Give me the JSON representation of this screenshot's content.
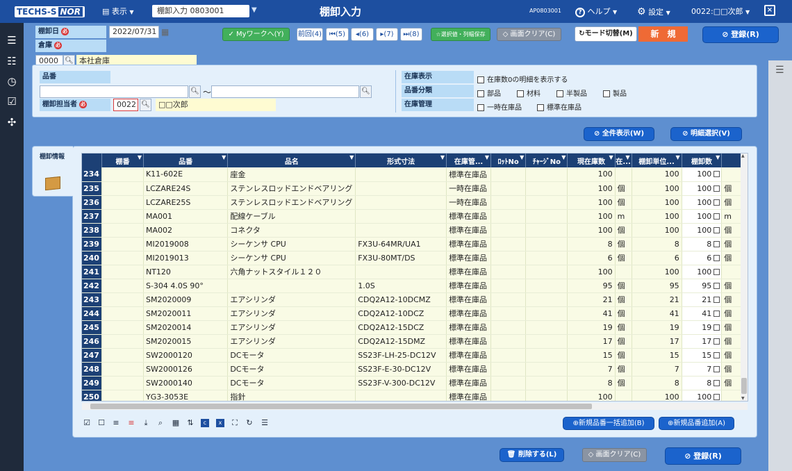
{
  "topbar": {
    "logo_left": "TECHS-S",
    "logo_right": "NOR",
    "view_menu": "表示",
    "screen_select": "棚卸入力 0803001",
    "title": "棚卸入力",
    "screen_code": "AP0803001",
    "help": "ヘルプ",
    "settings": "設定",
    "user": "0022:□□次郎"
  },
  "header": {
    "date_label": "棚卸日",
    "date_value": "2022/07/31",
    "warehouse_label": "倉庫",
    "warehouse_code": "0000",
    "warehouse_name": "本社倉庫",
    "required_mark": "必",
    "my_work_button": "Myワークへ(Y)",
    "prev_button": "前回(4)",
    "first_button": "(5)",
    "back_button": "(6)",
    "next_button": "(7)",
    "last_button": "(8)",
    "save_selection_button": "選択値・列幅保存",
    "clear_button": "画面クリア(C)",
    "mode_toggle_button": "モード切替(M)",
    "mode_label": "新　規",
    "register_button": "登録(R)"
  },
  "search": {
    "item_code_label": "品番",
    "tilde": "〜",
    "person_label": "棚卸担当者",
    "person_code": "0022",
    "person_name": "□□次郎",
    "stock_display_label": "在庫表示",
    "stock_display_option": "在庫数0の明細を表示する",
    "item_class_label": "品番分類",
    "item_class_options": [
      "部品",
      "材料",
      "半製品",
      "製品"
    ],
    "stock_mgmt_label": "在庫管理",
    "stock_mgmt_options": [
      "一時在庫品",
      "標準在庫品"
    ]
  },
  "actions": {
    "show_all_button": "全件表示(W)",
    "detail_select_button": "明細選択(V)"
  },
  "tab": {
    "label": "棚卸情報"
  },
  "grid": {
    "columns": [
      "",
      "棚番",
      "品番",
      "品名",
      "形式寸法",
      "在庫管...",
      "ﾛｯﾄNo",
      "ﾁｬｰｼﾞNo",
      "現在庫数",
      "在...",
      "棚卸単位...",
      "棚卸数",
      ""
    ],
    "rows": [
      {
        "no": "234",
        "shelf": "",
        "code": "K11-602E",
        "name": "座金",
        "spec": "",
        "mgmt": "標準在庫品",
        "lot": "",
        "charge": "",
        "stock": "100",
        "unit": "",
        "inv_unit": "100",
        "count": "100",
        "unit2": ""
      },
      {
        "no": "235",
        "shelf": "",
        "code": "LCZARE24S",
        "name": "ステンレスロッドエンドベアリング",
        "spec": "",
        "mgmt": "一時在庫品",
        "lot": "",
        "charge": "",
        "stock": "100",
        "unit": "個",
        "inv_unit": "100",
        "count": "100",
        "unit2": "個"
      },
      {
        "no": "236",
        "shelf": "",
        "code": "LCZARE25S",
        "name": "ステンレスロッドエンドベアリング",
        "spec": "",
        "mgmt": "一時在庫品",
        "lot": "",
        "charge": "",
        "stock": "100",
        "unit": "個",
        "inv_unit": "100",
        "count": "100",
        "unit2": "個"
      },
      {
        "no": "237",
        "shelf": "",
        "code": "MA001",
        "name": "配線ケーブル",
        "spec": "",
        "mgmt": "標準在庫品",
        "lot": "",
        "charge": "",
        "stock": "100",
        "unit": "m",
        "inv_unit": "100",
        "count": "100",
        "unit2": "m"
      },
      {
        "no": "238",
        "shelf": "",
        "code": "MA002",
        "name": "コネクタ",
        "spec": "",
        "mgmt": "標準在庫品",
        "lot": "",
        "charge": "",
        "stock": "100",
        "unit": "個",
        "inv_unit": "100",
        "count": "100",
        "unit2": "個"
      },
      {
        "no": "239",
        "shelf": "",
        "code": "MI2019008",
        "name": "シーケンサ CPU",
        "spec": "FX3U-64MR/UA1",
        "mgmt": "標準在庫品",
        "lot": "",
        "charge": "",
        "stock": "8",
        "unit": "個",
        "inv_unit": "8",
        "count": "8",
        "unit2": "個"
      },
      {
        "no": "240",
        "shelf": "",
        "code": "MI2019013",
        "name": "シーケンサ CPU",
        "spec": "FX3U-80MT/DS",
        "mgmt": "標準在庫品",
        "lot": "",
        "charge": "",
        "stock": "6",
        "unit": "個",
        "inv_unit": "6",
        "count": "6",
        "unit2": "個"
      },
      {
        "no": "241",
        "shelf": "",
        "code": "NT120",
        "name": "六角ナットスタイル１２０",
        "spec": "",
        "mgmt": "標準在庫品",
        "lot": "",
        "charge": "",
        "stock": "100",
        "unit": "",
        "inv_unit": "100",
        "count": "100",
        "unit2": ""
      },
      {
        "no": "242",
        "shelf": "",
        "code": "S-304 4.0S 90°",
        "name": "",
        "spec": "1.0S",
        "mgmt": "標準在庫品",
        "lot": "",
        "charge": "",
        "stock": "95",
        "unit": "個",
        "inv_unit": "95",
        "count": "95",
        "unit2": "個"
      },
      {
        "no": "243",
        "shelf": "",
        "code": "SM2020009",
        "name": "エアシリンダ",
        "spec": "CDQ2A12-10DCMZ",
        "mgmt": "標準在庫品",
        "lot": "",
        "charge": "",
        "stock": "21",
        "unit": "個",
        "inv_unit": "21",
        "count": "21",
        "unit2": "個"
      },
      {
        "no": "244",
        "shelf": "",
        "code": "SM2020011",
        "name": "エアシリンダ",
        "spec": "CDQ2A12-10DCZ",
        "mgmt": "標準在庫品",
        "lot": "",
        "charge": "",
        "stock": "41",
        "unit": "個",
        "inv_unit": "41",
        "count": "41",
        "unit2": "個"
      },
      {
        "no": "245",
        "shelf": "",
        "code": "SM2020014",
        "name": "エアシリンダ",
        "spec": "CDQ2A12-15DCZ",
        "mgmt": "標準在庫品",
        "lot": "",
        "charge": "",
        "stock": "19",
        "unit": "個",
        "inv_unit": "19",
        "count": "19",
        "unit2": "個"
      },
      {
        "no": "246",
        "shelf": "",
        "code": "SM2020015",
        "name": "エアシリンダ",
        "spec": "CDQ2A12-15DMZ",
        "mgmt": "標準在庫品",
        "lot": "",
        "charge": "",
        "stock": "17",
        "unit": "個",
        "inv_unit": "17",
        "count": "17",
        "unit2": "個"
      },
      {
        "no": "247",
        "shelf": "",
        "code": "SW2000120",
        "name": "DCモータ",
        "spec": "SS23F-LH-25-DC12V",
        "mgmt": "標準在庫品",
        "lot": "",
        "charge": "",
        "stock": "15",
        "unit": "個",
        "inv_unit": "15",
        "count": "15",
        "unit2": "個"
      },
      {
        "no": "248",
        "shelf": "",
        "code": "SW2000126",
        "name": "DCモータ",
        "spec": "SS23F-E-30-DC12V",
        "mgmt": "標準在庫品",
        "lot": "",
        "charge": "",
        "stock": "7",
        "unit": "個",
        "inv_unit": "7",
        "count": "7",
        "unit2": "個"
      },
      {
        "no": "249",
        "shelf": "",
        "code": "SW2000140",
        "name": "DCモータ",
        "spec": "SS23F-V-300-DC12V",
        "mgmt": "標準在庫品",
        "lot": "",
        "charge": "",
        "stock": "8",
        "unit": "個",
        "inv_unit": "8",
        "count": "8",
        "unit2": "個"
      },
      {
        "no": "250",
        "shelf": "",
        "code": "YG3-3053E",
        "name": "指針",
        "spec": "",
        "mgmt": "標準在庫品",
        "lot": "",
        "charge": "",
        "stock": "100",
        "unit": "",
        "inv_unit": "100",
        "count": "100",
        "unit2": ""
      }
    ]
  },
  "grid_footer": {
    "bulk_add_button": "新規品番一括追加(B)",
    "add_button": "新規品番追加(A)"
  },
  "bottom": {
    "delete_button": "削除する(L)",
    "clear_button": "画面クリア(C)",
    "register_button": "登録(R)"
  },
  "colors": {
    "topbar": "#1d4fa0",
    "leftnav": "#1f2a3b",
    "body": "#5e8fd0",
    "panel": "#e4f0fb",
    "grid_header": "#1c4075",
    "row": "#f9fbe5",
    "mode_badge": "#ef6a35"
  }
}
